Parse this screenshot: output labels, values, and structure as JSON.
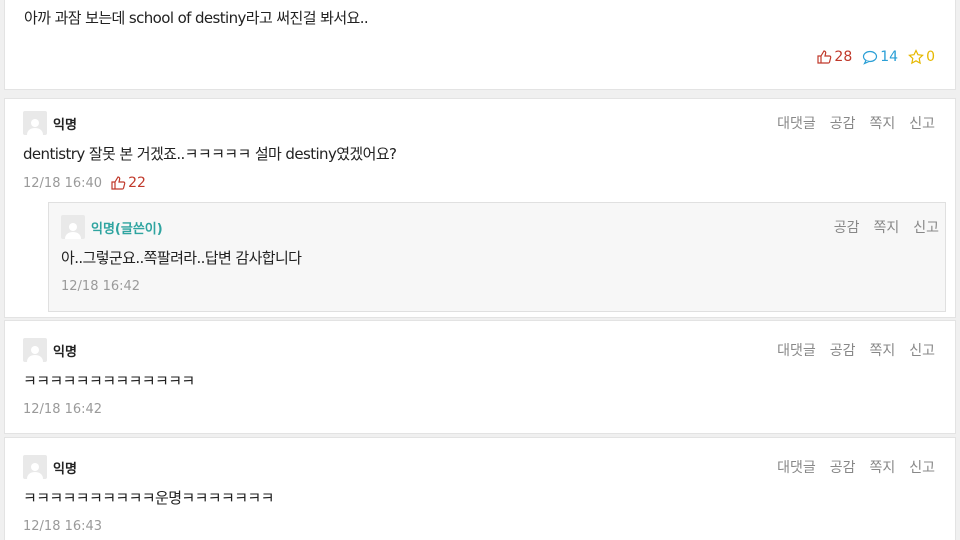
{
  "post": {
    "text": "아까 과잠 보는데 school of destiny라고 써진걸 봐서요..",
    "likes": "28",
    "comments": "14",
    "scraps": "0"
  },
  "actions": {
    "reply": "대댓글",
    "like": "공감",
    "message": "쪽지",
    "report": "신고"
  },
  "comments": [
    {
      "author": "익명",
      "text": "dentistry 잘못 본 거겠죠..ㅋㅋㅋㅋㅋ 설마 destiny였겠어요?",
      "time": "12/18 16:40",
      "votes": "22",
      "reply": {
        "author": "익명(글쓴이)",
        "text": "아..그렇군요..쪽팔려라..답변 감사합니다",
        "time": "12/18 16:42"
      }
    },
    {
      "author": "익명",
      "text": "ㅋㅋㅋㅋㅋㅋㅋㅋㅋㅋㅋㅋㅋ",
      "time": "12/18 16:42"
    },
    {
      "author": "익명",
      "text": "ㅋㅋㅋㅋㅋㅋㅋㅋㅋㅋ운명ㅋㅋㅋㅋㅋㅋㅋ",
      "time": "12/18 16:43"
    }
  ],
  "icons": {
    "like": "thumbs-up-icon",
    "comment": "speech-bubble-icon",
    "scrap": "star-icon",
    "avatar": "person-icon"
  },
  "colors": {
    "like": "#c0392b",
    "comment": "#2a9fd6",
    "scrap": "#e6b800",
    "op_author": "#2fa4a0"
  }
}
